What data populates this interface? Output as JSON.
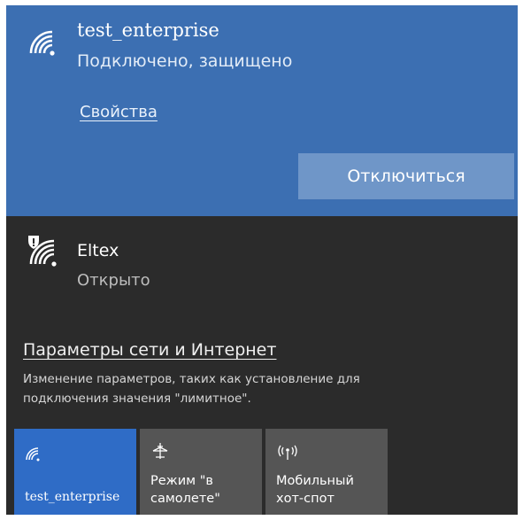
{
  "connected_network": {
    "name": "test_enterprise",
    "status": "Подключено, защищено",
    "properties_link": "Свойства",
    "disconnect_button": "Отключиться"
  },
  "other_network": {
    "name": "Eltex",
    "status": "Открыто"
  },
  "settings": {
    "link": "Параметры сети и Интернет",
    "description_line1": "Изменение параметров, таких как установление для",
    "description_line2": "подключения значения \"лимитное\"."
  },
  "quick_actions": [
    {
      "label": "test_enterprise",
      "icon": "wifi-icon",
      "active": true
    },
    {
      "label_line1": "Режим \"в",
      "label_line2": "самолете\"",
      "icon": "airplane-icon",
      "active": false
    },
    {
      "label_line1": "Мобильный",
      "label_line2": "хот-спот",
      "icon": "hotspot-icon",
      "active": false
    }
  ],
  "colors": {
    "connected_bg": "#3c6fb2",
    "panel_bg": "#2b2b2b",
    "tile_active": "#2f6cc6",
    "tile_inactive": "#555555",
    "button_bg": "#6f96c8"
  }
}
